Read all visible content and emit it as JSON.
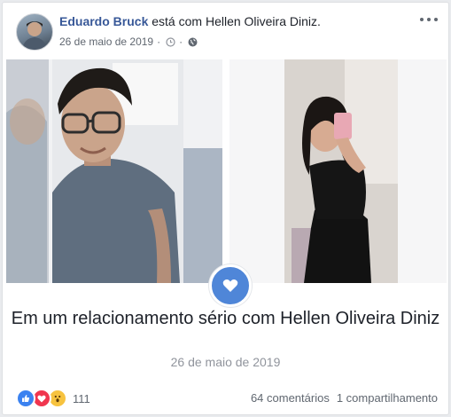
{
  "post": {
    "author": "Eduardo Bruck",
    "connector": "está com",
    "tagged": "Hellen Oliveira Diniz.",
    "date": "26 de maio de 2019",
    "separator": "·",
    "icons": [
      "clock-icon",
      "globe-icon",
      "more-options-icon"
    ]
  },
  "life_event": {
    "icon": "heart-icon",
    "badge_color": "#4f86d8",
    "text": "Em um relacionamento sério com Hellen Oliveira Diniz",
    "date": "26 de maio de 2019"
  },
  "footer": {
    "reactions": [
      "like-icon",
      "love-icon",
      "wow-icon"
    ],
    "reaction_count": "111",
    "comments": "64 comentários",
    "shares": "1 compartilhamento"
  },
  "colors": {
    "link": "#385898",
    "text": "#1d2129",
    "muted": "#606770"
  }
}
